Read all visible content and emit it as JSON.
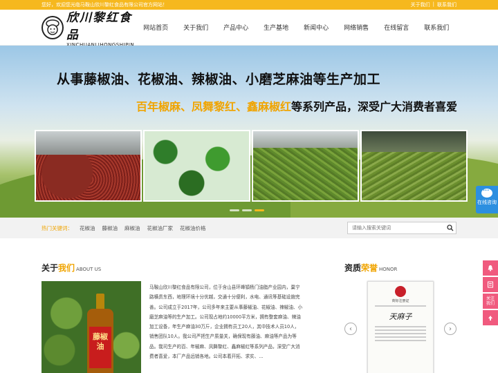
{
  "topbar": {
    "welcome": "您好，欢迎您光临马鞍山欣川黎红食品有限公司官方网站！",
    "links": [
      "关于我们",
      "|",
      "联系我们"
    ]
  },
  "logo": {
    "cn": "欣川黎红食品",
    "en": "XINCHUANLIHONGSHIPIN"
  },
  "nav": [
    "网站首页",
    "关于我们",
    "产品中心",
    "生产基地",
    "新闻中心",
    "网络销售",
    "在线留言",
    "联系我们"
  ],
  "banner": {
    "title": "从事藤椒油、花椒油、辣椒油、小磨芝麻油等生产加工",
    "sub_highlight": "百年椒麻、凤舞黎红、鑫麻椒红",
    "sub_rest": "等系列产品，深受广大消费者喜爱",
    "slides": 3,
    "active_slide": 3
  },
  "online_service": {
    "label": "在线咨询"
  },
  "search": {
    "hot_label": "热门关键词：",
    "hot_keywords": [
      "花椒油",
      "藤椒油",
      "麻椒油",
      "花椒油厂家",
      "花椒油价格"
    ],
    "placeholder": "请输入搜索关键词"
  },
  "about": {
    "title_main": "关于",
    "title_highlight": "我们",
    "title_en": "ABOUT US",
    "bottle_label": "藤椒油",
    "text": "马鞍山欣川黎红食品有限公司，位于含山县环峰镇杨门油脂产业园内，巢宁路横贯东西，地理环境十分优越，交通十分便利，水电、通讯等基础设施完善。公司成立于2017年，公司多年来主要从事藤椒油、花椒油、辣椒油、小磨芝麻油等的生产加工。公司现占地约10000平方米，拥有整套麻油、辣油加工设备，年生产麻油30万斤，企业拥有员工20人，其中技术人员10人，销售团队10人。我公司严把生产质量关，确保现有藤油、麻油等产品为等品。我司生产的百、年椒麻、凤舞黎红、鑫麻椒红等系列产品，深受广大消费者喜爱，本厂产品远销各地。公司本着开拓、求实、..."
  },
  "honor": {
    "title_main": "资质",
    "title_highlight": "荣誉",
    "title_en": "HONOR",
    "cert_title": "商标注册证",
    "cert_mark": "天麻子",
    "prev": "‹",
    "next": "›"
  },
  "tools": [
    "",
    "",
    "关注\n我们",
    ""
  ],
  "colors": {
    "accent": "#f6b81e",
    "highlight": "#f0a400",
    "service": "#2c8fe0",
    "tool": "#f05a7e"
  }
}
